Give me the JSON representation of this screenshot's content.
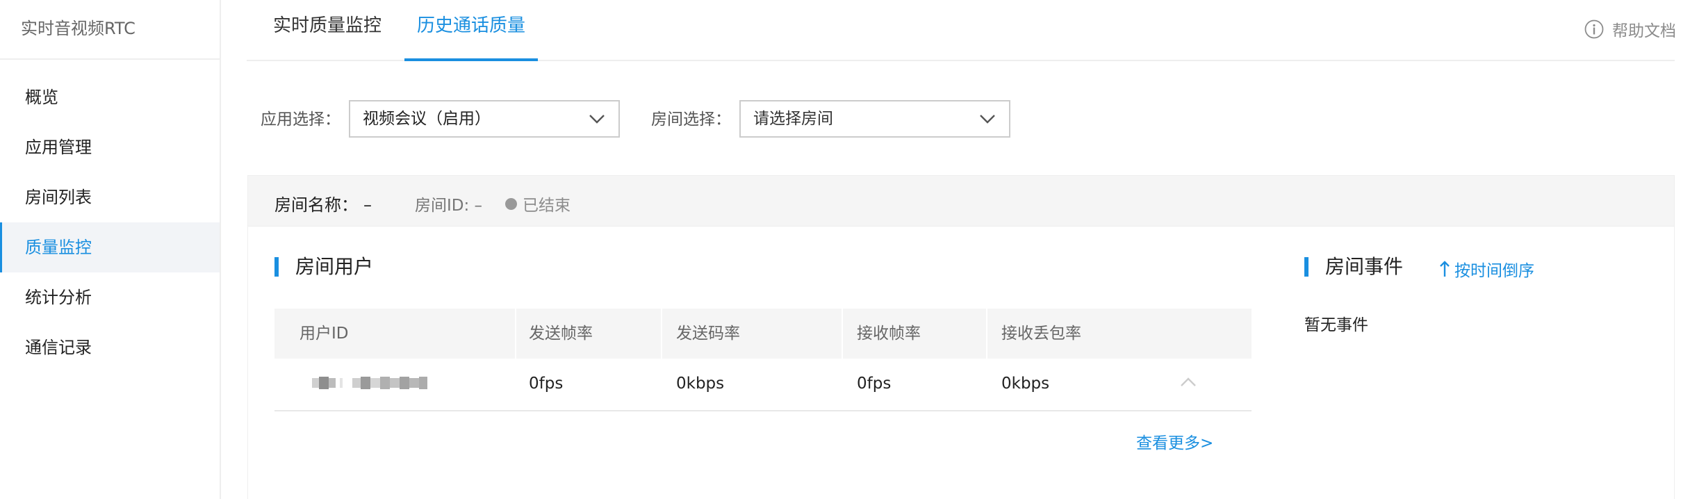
{
  "sidebar": {
    "title": "实时音视频RTC",
    "items": [
      {
        "label": "概览"
      },
      {
        "label": "应用管理"
      },
      {
        "label": "房间列表"
      },
      {
        "label": "质量监控"
      },
      {
        "label": "统计分析"
      },
      {
        "label": "通信记录"
      }
    ],
    "active_index": 3
  },
  "tabs": [
    {
      "label": "实时质量监控"
    },
    {
      "label": "历史通话质量"
    }
  ],
  "help": {
    "label": "帮助文档",
    "icon": "info-icon"
  },
  "filters": {
    "app_label": "应用选择：",
    "app_value": "视频会议（启用）",
    "room_label": "房间选择：",
    "room_placeholder": "请选择房间"
  },
  "room_info": {
    "name_label": "房间名称：",
    "name_value": "–",
    "id_label": "房间ID: –",
    "status": "已结束"
  },
  "users": {
    "title": "房间用户",
    "columns": [
      "用户ID",
      "发送帧率",
      "发送码率",
      "接收帧率",
      "接收丢包率"
    ],
    "rows": [
      {
        "user_id": "",
        "send_fps": "0fps",
        "send_bitrate": "0kbps",
        "recv_fps": "0fps",
        "recv_loss": "0kbps"
      }
    ],
    "more_label": "查看更多>"
  },
  "events": {
    "title": "房间事件",
    "sort_label": "按时间倒序",
    "empty_label": "暂无事件"
  },
  "colors": {
    "accent": "#1a8fe0",
    "status_ended": "#999999"
  }
}
